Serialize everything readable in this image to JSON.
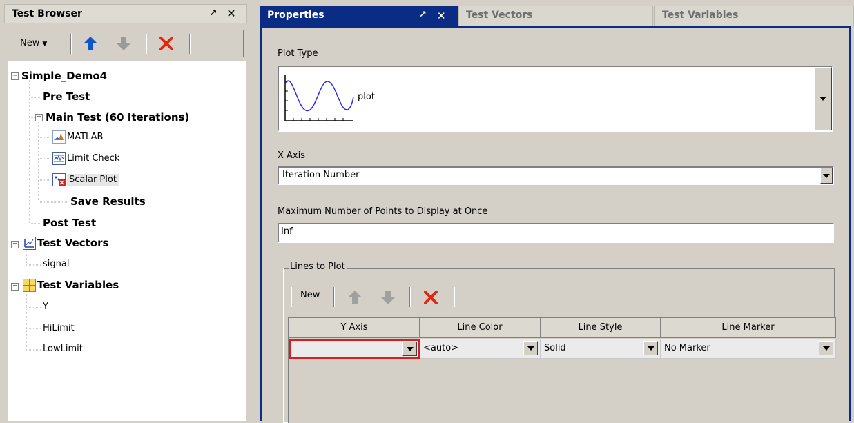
{
  "test_browser": {
    "title": "Test Browser",
    "toolbar": {
      "new_label": "New"
    },
    "tree": [
      {
        "label": "Simple_Demo4",
        "bold": true
      },
      {
        "label": "Pre Test",
        "bold": true
      },
      {
        "label": "Main Test (60 Iterations)",
        "bold": true
      },
      {
        "label": "MATLAB",
        "bold": false,
        "icon": "matlab-icon"
      },
      {
        "label": "Limit Check",
        "bold": false,
        "icon": "limit-check-icon"
      },
      {
        "label": "Scalar Plot",
        "bold": false,
        "icon": "scalar-plot-icon",
        "selected": true
      },
      {
        "label": "Save Results",
        "bold": true
      },
      {
        "label": "Post Test",
        "bold": true
      },
      {
        "label": "Test Vectors",
        "bold": true,
        "icon": "test-vectors-icon"
      },
      {
        "label": "signal",
        "bold": false
      },
      {
        "label": "Test Variables",
        "bold": true,
        "icon": "test-variables-icon"
      },
      {
        "label": "Y",
        "bold": false
      },
      {
        "label": "HiLimit",
        "bold": false
      },
      {
        "label": "LowLimit",
        "bold": false
      }
    ]
  },
  "tabs": [
    {
      "label": "Properties",
      "active": true
    },
    {
      "label": "Test Vectors",
      "active": false
    },
    {
      "label": "Test Variables",
      "active": false
    }
  ],
  "properties": {
    "plot_type_label": "Plot Type",
    "plot_type_value": "plot",
    "x_axis_label": "X Axis",
    "x_axis_value": "Iteration Number",
    "max_points_label": "Maximum Number of Points to Display at Once",
    "max_points_value": "Inf",
    "lines_group_label": "Lines to Plot",
    "lines_toolbar_new": "New",
    "columns": [
      "Y Axis",
      "Line Color",
      "Line Style",
      "Line Marker"
    ],
    "rows": [
      {
        "y_axis": "",
        "line_color": "<auto>",
        "line_style": "Solid",
        "line_marker": "No Marker"
      }
    ]
  },
  "colors": {
    "active_tab": "#0a2c84",
    "selection_border": "#d42020",
    "arrow_blue": "#0d55c8",
    "delete_red": "#e02810"
  }
}
